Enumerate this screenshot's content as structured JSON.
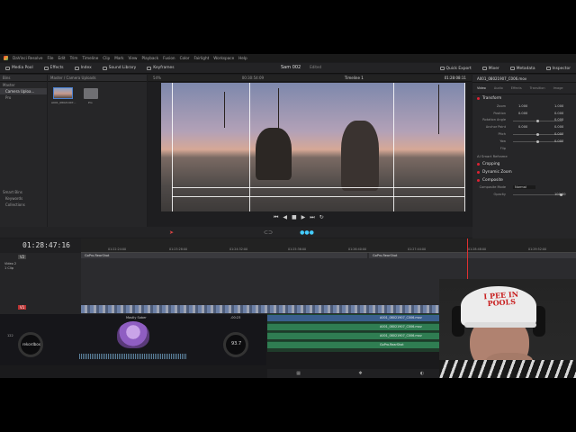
{
  "menubar": {
    "items": [
      "DaVinci Resolve",
      "File",
      "Edit",
      "Trim",
      "Timeline",
      "Clip",
      "Mark",
      "View",
      "Playback",
      "Fusion",
      "Color",
      "Fairlight",
      "Workspace",
      "Help"
    ]
  },
  "toolbar": {
    "media_pool": "Media Pool",
    "effects": "Effects",
    "index": "Index",
    "sound_library": "Sound Library",
    "keyframes": "Keyframes",
    "project_title": "Sam 002",
    "project_status": "Edited",
    "quick_export": "Quick Export",
    "mixer": "Mixer",
    "metadata": "Metadata",
    "inspector": "Inspector"
  },
  "bins": {
    "header": "Bins",
    "master": "Master",
    "items": [
      "Camera Uploa...",
      "Pro"
    ],
    "smart_header": "Smart Bins",
    "smart_items": [
      "Keywords",
      "Collections"
    ]
  },
  "media": {
    "path": "Master / Camera Uploads",
    "clips": [
      "A001_08021907...",
      "Pro"
    ]
  },
  "viewer": {
    "zoom": "54%",
    "source_tc": "00:30:54:09",
    "timeline_name": "Timeline 1",
    "record_tc": "01:28:08:11"
  },
  "inspector": {
    "clip_name": "A001_08021907_C006.mov",
    "tabs": [
      "Video",
      "Audio",
      "Effects",
      "Transition",
      "Image"
    ],
    "sections": {
      "transform": "Transform",
      "ai_smart_reframe": "AI Smart Reframe",
      "cropping": "Cropping",
      "dynamic_zoom": "Dynamic Zoom",
      "composite": "Composite"
    },
    "props": [
      {
        "label": "Zoom",
        "x": "1.000",
        "y": "1.000",
        "slider": 0.5
      },
      {
        "label": "Position",
        "x": "0.000",
        "y": "0.000",
        "slider": 0.5
      },
      {
        "label": "Rotation Angle",
        "x": "",
        "y": "0.000",
        "slider": 0.5
      },
      {
        "label": "Anchor Point",
        "x": "0.000",
        "y": "0.000",
        "slider": 0.5
      },
      {
        "label": "Pitch",
        "x": "",
        "y": "0.000",
        "slider": 0.5
      },
      {
        "label": "Yaw",
        "x": "",
        "y": "0.000",
        "slider": 0.5
      },
      {
        "label": "Flip",
        "x": "",
        "y": "",
        "slider": 0
      }
    ],
    "composite_mode_label": "Composite Mode",
    "composite_mode": "Normal",
    "opacity_label": "Opacity",
    "opacity": "100.00"
  },
  "timeline": {
    "timecode": "01:28:47:16",
    "ruler_ticks": [
      "01:22:24:00",
      "01:23:28:00",
      "01:24:32:00",
      "01:25:36:00",
      "01:26:40:00",
      "01:27:44:00",
      "01:28:48:00",
      "01:29:52:00"
    ],
    "tracks": {
      "v2": "V2",
      "v2_name": "Video 2",
      "v2_clips": "1 Clip",
      "v1": "V1"
    },
    "v2_clip_labels": [
      "GoPro.RearShot",
      "GoPro.RearShot"
    ]
  },
  "audio": {
    "clip_labels": [
      "A001_08021907_C006.mov",
      "A001_08021907_C006.mov",
      "A001_08021907_C006.mov",
      "GoPro.RearShot"
    ]
  },
  "dj": {
    "deck_title": "Mostly Sober",
    "time": "-00:23",
    "bpm_a": "122",
    "bpm_b": "93.7",
    "brand": "rekordbox"
  },
  "webcam": {
    "cap_text": "I PEE IN POOLS"
  }
}
